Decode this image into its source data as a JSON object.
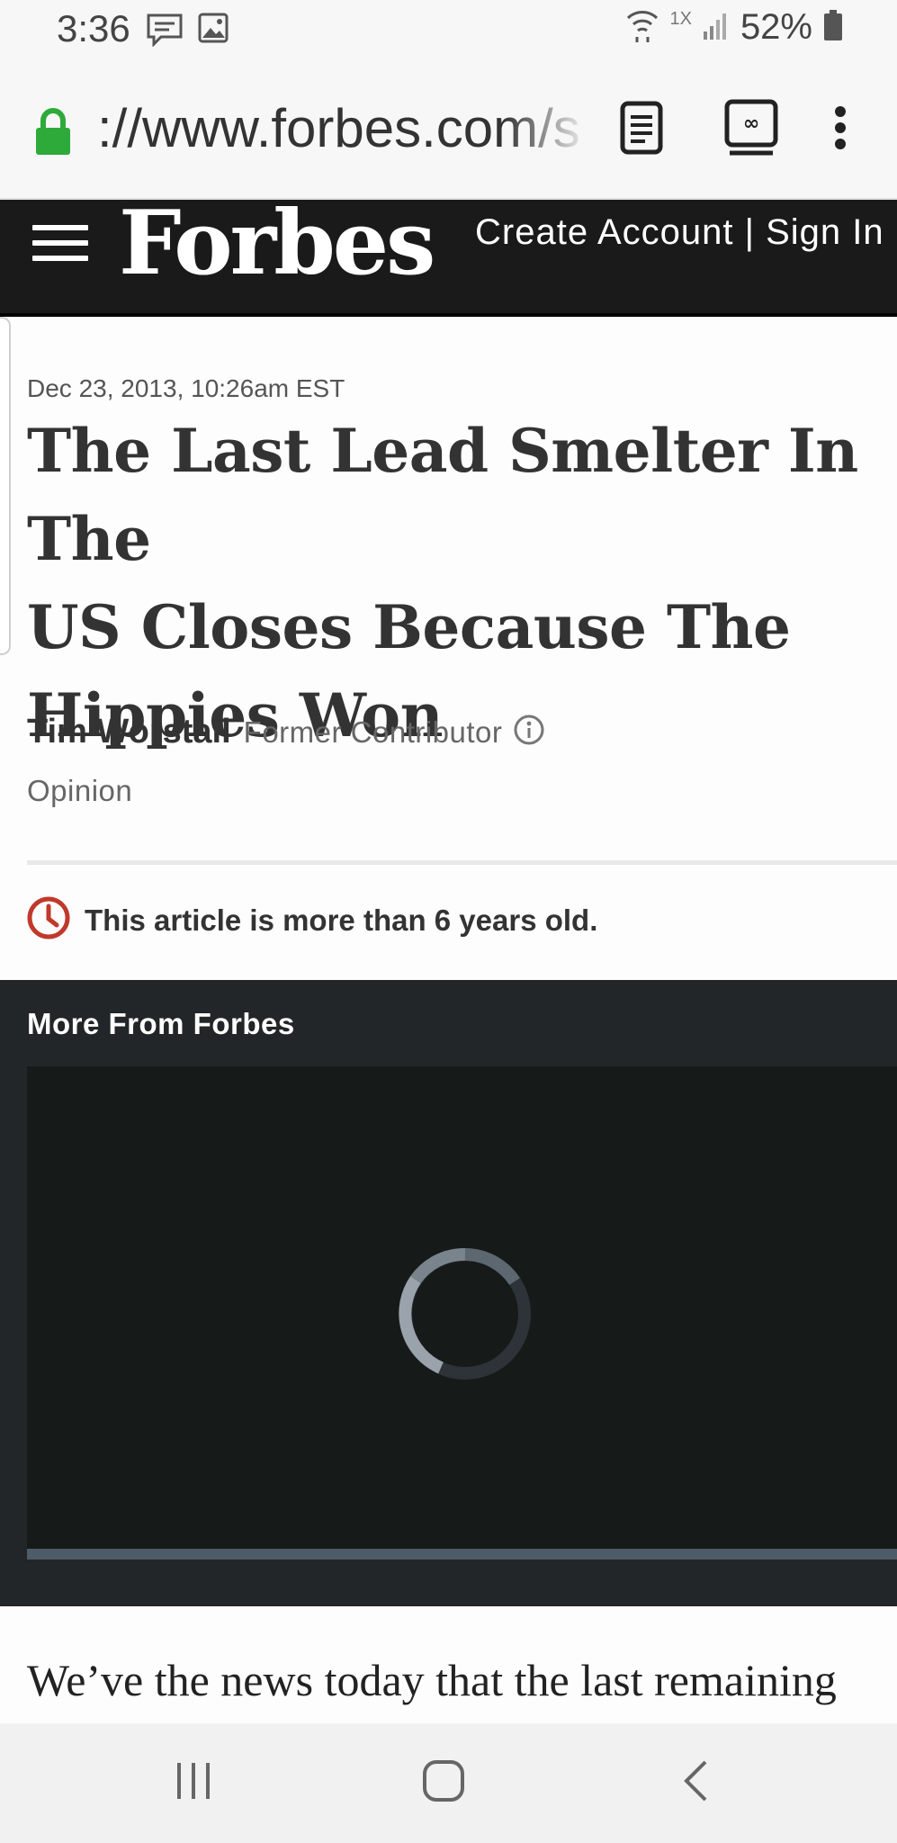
{
  "status_bar": {
    "time": "3:36",
    "network_label": "1X",
    "battery": "52%"
  },
  "browser": {
    "url": "://www.forbes.com/sites/timworstall",
    "lock_color": "#2eaa3a"
  },
  "site_header": {
    "logo": "Forbes",
    "links": "Create Account | Sign In"
  },
  "article": {
    "dateline": "Dec 23, 2013, 10:26am EST",
    "headline_lines": [
      "The Last Lead Smelter In The",
      "US Closes Because The",
      "Hippies Won"
    ],
    "author": "Tim Worstall",
    "author_role": "Former Contributor",
    "section": "Opinion",
    "old_notice": "This article is more than 6 years old.",
    "notice_color": "#c0392b",
    "body_first_line": "We’ve the news today that the last remaining"
  },
  "more_from": {
    "title": "More From Forbes"
  },
  "icons": {
    "status": [
      "message-icon",
      "image-icon",
      "wifi-icon",
      "signal-icon",
      "battery-icon"
    ],
    "browser": [
      "lock-icon",
      "reader-mode-icon",
      "tab-switcher-icon",
      "more-options-icon"
    ],
    "nav": [
      "recent-apps-icon",
      "home-icon",
      "back-icon"
    ]
  }
}
